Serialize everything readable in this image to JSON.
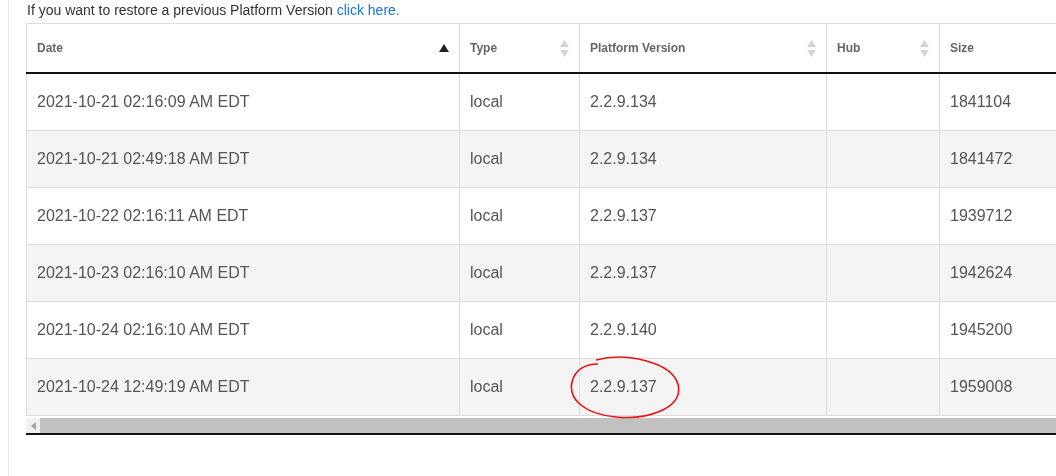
{
  "notice": {
    "text": "If you want to restore a previous Platform Version ",
    "link": "click here."
  },
  "table": {
    "columns": [
      {
        "label": "Date",
        "sorted": true
      },
      {
        "label": "Type",
        "sorted": false
      },
      {
        "label": "Platform Version",
        "sorted": false
      },
      {
        "label": "Hub",
        "sorted": false
      },
      {
        "label": "Size"
      }
    ],
    "rows": [
      {
        "cells": [
          "2021-10-21 02:16:09 AM EDT",
          "local",
          "2.2.9.134",
          "",
          "1841104"
        ],
        "circled": false
      },
      {
        "cells": [
          "2021-10-21 02:49:18 AM EDT",
          "local",
          "2.2.9.134",
          "",
          "1841472"
        ],
        "circled": false
      },
      {
        "cells": [
          "2021-10-22 02:16:11 AM EDT",
          "local",
          "2.2.9.137",
          "",
          "1939712"
        ],
        "circled": false
      },
      {
        "cells": [
          "2021-10-23 02:16:10 AM EDT",
          "local",
          "2.2.9.137",
          "",
          "1942624"
        ],
        "circled": false
      },
      {
        "cells": [
          "2021-10-24 02:16:10 AM EDT",
          "local",
          "2.2.9.140",
          "",
          "1945200"
        ],
        "circled": false
      },
      {
        "cells": [
          "2021-10-24 12:49:19 AM EDT",
          "local",
          "2.2.9.137",
          "",
          "1959008"
        ],
        "circled": true
      }
    ]
  }
}
